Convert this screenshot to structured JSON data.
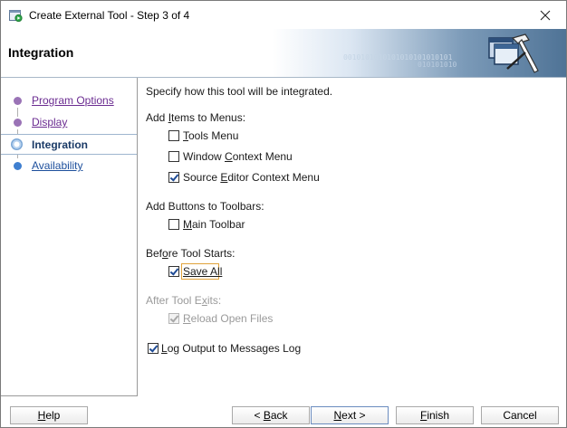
{
  "window": {
    "title": "Create External Tool - Step 3 of 4"
  },
  "header": {
    "title": "Integration",
    "binary_1": "0010101010101010101010101",
    "binary_2": "010101010"
  },
  "steps": [
    {
      "label": "Program Options",
      "state": "visited"
    },
    {
      "label": "Display",
      "state": "visited"
    },
    {
      "label": "Integration",
      "state": "current"
    },
    {
      "label": "Availability",
      "state": "link"
    }
  ],
  "content": {
    "intro": "Specify how this tool will be integrated.",
    "menus_heading": {
      "pre": "Add ",
      "key": "I",
      "post": "tems to Menus:"
    },
    "menu_items": [
      {
        "pre": "",
        "key": "T",
        "post": "ools Menu",
        "checked": false
      },
      {
        "pre": "Window ",
        "key": "C",
        "post": "ontext Menu",
        "checked": false
      },
      {
        "pre": "Source ",
        "key": "E",
        "post": "ditor Context Menu",
        "checked": true
      }
    ],
    "toolbars_heading": "Add Buttons to Toolbars:",
    "toolbar_item": {
      "pre": "",
      "key": "M",
      "post": "ain Toolbar",
      "checked": false
    },
    "before_heading": {
      "pre": "Bef",
      "key": "o",
      "post": "re Tool Starts:"
    },
    "save_all": {
      "label": "Save All",
      "checked": true
    },
    "after_heading": {
      "pre": "After Tool E",
      "key": "x",
      "post": "its:"
    },
    "reload": {
      "pre": "",
      "key": "R",
      "post": "eload Open Files",
      "checked": true,
      "disabled": true
    },
    "log_output": {
      "pre": "",
      "key": "L",
      "post": "og Output to Messages Log",
      "checked": true
    }
  },
  "buttons": {
    "help": {
      "pre": "",
      "key": "H",
      "post": "elp"
    },
    "back": {
      "pre": "< ",
      "key": "B",
      "post": "ack"
    },
    "next": {
      "pre": "",
      "key": "N",
      "post": "ext >"
    },
    "finish": {
      "pre": "",
      "key": "F",
      "post": "inish"
    },
    "cancel": "Cancel"
  },
  "colors": {
    "visited_step": "#6b2c91",
    "link_step": "#1d4f9c",
    "check": "#1f4c96",
    "focus": "#e0a23a"
  }
}
